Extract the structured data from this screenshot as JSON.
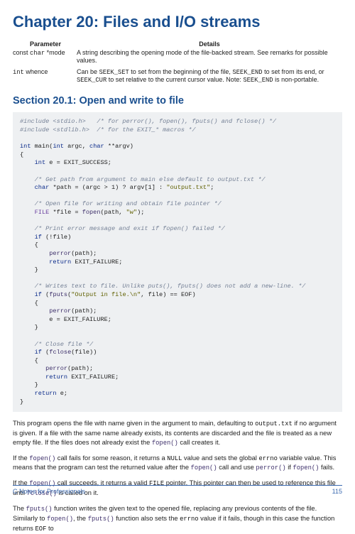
{
  "chapter": {
    "title": "Chapter 20: Files and I/O streams"
  },
  "param_table": {
    "headers": {
      "param": "Parameter",
      "details": "Details"
    },
    "rows": [
      {
        "param_html": "const <span class='mono'>char</span> *mode",
        "details_html": "A string describing the opening mode of the file-backed stream. See remarks for possible values."
      },
      {
        "param_html": "<span class='mono'>int</span> whence",
        "details_html": "Can be <span class='mono'>SEEK_SET</span> to set from the beginning of the file, <span class='mono'>SEEK_END</span> to set from its end, or <span class='mono'>SEEK_CUR</span> to set relative to the current cursor value. Note: <span class='mono'>SEEK_END</span> is non-portable."
      }
    ]
  },
  "section": {
    "title": "Section 20.1: Open and write to file"
  },
  "code_block_html": "<span class='cm'>#include &lt;stdio.h&gt;   /* for perror(), fopen(), fputs() and fclose() */</span>\n<span class='cm'>#include &lt;stdlib.h&gt;  /* for the EXIT_* macros */</span>\n\n<span class='kw'>int</span> main(<span class='kw'>int</span> argc, <span class='kw'>char</span> **argv)\n{\n    <span class='kw'>int</span> e = EXIT_SUCCESS;\n\n    <span class='cm'>/* Get path from argument to main else default to output.txt */</span>\n    <span class='kw'>char</span> *path = (argc > <span class='num'>1</span>) ? argv[<span class='num'>1</span>] : <span class='str'>\"output.txt\"</span>;\n\n    <span class='cm'>/* Open file for writing and obtain file pointer */</span>\n    <span class='ty'>FILE</span> *file = <span class='fn'>fopen</span>(path, <span class='str'>\"w\"</span>);\n\n    <span class='cm'>/* Print error message and exit if fopen() failed */</span>\n    <span class='kw'>if</span> (!file)\n    {\n        <span class='fn'>perror</span>(path);\n        <span class='kw'>return</span> EXIT_FAILURE;\n    }\n\n    <span class='cm'>/* Writes text to file. Unlike puts(), fputs() does not add a new-line. */</span>\n    <span class='kw'>if</span> (<span class='fn'>fputs</span>(<span class='str'>\"Output in file.\\n\"</span>, file) == EOF)\n    {\n        <span class='fn'>perror</span>(path);\n        e = EXIT_FAILURE;\n    }\n\n    <span class='cm'>/* Close file */</span>\n    <span class='kw'>if</span> (<span class='fn'>fclose</span>(file))\n    {\n       <span class='fn'>perror</span>(path);\n       <span class='kw'>return</span> EXIT_FAILURE;\n    }\n    <span class='kw'>return</span> e;\n}",
  "paragraphs": {
    "p1_html": "This program opens the file with name given in the argument to main, defaulting to <span class='inlk'>output.txt</span> if no argument is given. If a file with the same name already exists, its contents are discarded and the file is treated as a new empty file. If the files does not already exist the <span class='inl'>fopen()</span> call creates it.",
    "p2_html": "If the <span class='inl'>fopen()</span> call fails for some reason, it returns a <span class='inlk'>NULL</span> value and sets the global <span class='inlk'>errno</span> variable value. This means that the program can test the returned value after the <span class='inl'>fopen()</span> call and use <span class='inl'>perror()</span> if <span class='inl'>fopen()</span> fails.",
    "p3_html": "If the <span class='inl'>fopen()</span> call succeeds, it returns a valid <span class='inlk'>FILE</span> pointer. This pointer can then be used to reference this file until <span class='inl'>fclose()</span> is called on it.",
    "p4_html": "The <span class='inl'>fputs()</span> function writes the given text to the opened file, replacing any previous contents of the file. Similarly to <span class='inl'>fopen()</span>, the <span class='inl'>fputs()</span> function also sets the <span class='inlk'>errno</span> value if it fails, though in this case the function returns <span class='inlk'>EOF</span> to"
  },
  "footer": {
    "left": "C Notes for Professionals",
    "right": "115"
  }
}
